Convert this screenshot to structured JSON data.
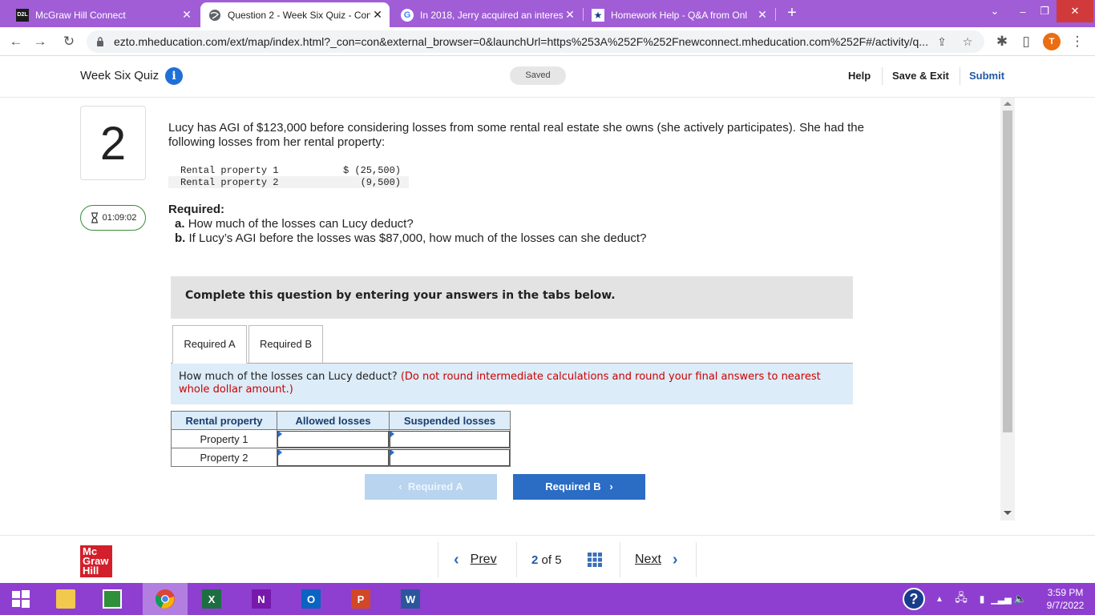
{
  "browser": {
    "tabs": [
      {
        "title": "McGraw Hill Connect",
        "favicon": "D2L"
      },
      {
        "title": "Question 2 - Week Six Quiz - Con",
        "favicon": "globe"
      },
      {
        "title": "In 2018, Jerry acquired an interes",
        "favicon": "G"
      },
      {
        "title": "Homework Help - Q&A from Onl",
        "favicon": "star"
      }
    ],
    "url": "ezto.mheducation.com/ext/map/index.html?_con=con&external_browser=0&launchUrl=https%253A%252F%252Fnewconnect.mheducation.com%252F#/activity/q...",
    "avatar": "T"
  },
  "header": {
    "quiz_title": "Week Six Quiz",
    "saved": "Saved",
    "help": "Help",
    "save_exit": "Save & Exit",
    "submit": "Submit"
  },
  "question": {
    "number": "2",
    "timer": "01:09:02",
    "text": "Lucy has AGI of $123,000 before considering losses from some rental real estate she owns (she actively participates). She had the following losses from her rental property:",
    "properties": [
      {
        "label": "Rental property 1",
        "value": "$ (25,500)"
      },
      {
        "label": "Rental property 2",
        "value": "(9,500)"
      }
    ],
    "required_heading": "Required:",
    "required_a_prefix": "a.",
    "required_a": "How much of the losses can Lucy deduct?",
    "required_b_prefix": "b.",
    "required_b": "If Lucy’s AGI before the losses was $87,000, how much of the losses can she deduct?"
  },
  "answer_panel": {
    "instructions": "Complete this question by entering your answers in the tabs below.",
    "tabs": [
      "Required A",
      "Required B"
    ],
    "prompt": "How much of the losses can Lucy deduct?",
    "hint": "(Do not round intermediate calculations and round your final answers to nearest whole dollar amount.)",
    "columns": [
      "Rental property",
      "Allowed losses",
      "Suspended losses"
    ],
    "rows": [
      "Property 1",
      "Property 2"
    ],
    "prev_button": "Required A",
    "next_button": "Required B"
  },
  "footer": {
    "logo": [
      "Mc",
      "Graw",
      "Hill"
    ],
    "prev": "Prev",
    "page_current": "2",
    "page_of": "of",
    "page_total": "5",
    "next": "Next"
  },
  "taskbar": {
    "time": "3:59 PM",
    "date": "9/7/2022"
  },
  "colors": {
    "chrome_purple": "#a05dd6",
    "taskbar_purple": "#8e3fd0",
    "primary_blue": "#2b6cc4",
    "hint_red": "#cc0000",
    "brand_red": "#d21f2b"
  }
}
